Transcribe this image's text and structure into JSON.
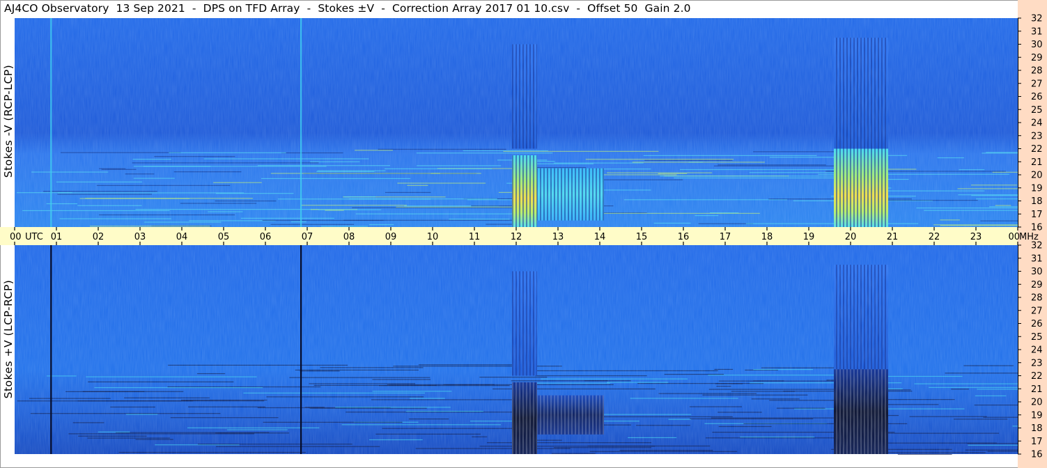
{
  "title": "AJ4CO Observatory  13 Sep 2021  -  DPS on TFD Array  -  Stokes ±V  -  Correction Array 2017 01 10.csv  -  Offset 50  Gain 2.0",
  "colors": {
    "background_blue": "#1f5fe0",
    "axis_band": "#fffcc8",
    "freq_band": "#ffdcc4",
    "cyan": "#40e0f0",
    "yellow": "#f0e040",
    "dark": "#06123a"
  },
  "chart_data": [
    {
      "type": "heatmap",
      "name": "stokes-minus-v",
      "ylabel": "Stokes -V (RCP-LCP)",
      "yunit": "MHz",
      "ylim": [
        16,
        32
      ],
      "yticks": [
        "16",
        "17",
        "18",
        "19",
        "20",
        "21",
        "22",
        "23",
        "24",
        "25",
        "26",
        "27",
        "28",
        "29",
        "30",
        "31",
        "32"
      ],
      "events": [
        {
          "start_utc": 11.9,
          "end_utc": 12.5,
          "fmin": 16,
          "fmax": 21.5,
          "kind": "bright"
        },
        {
          "start_utc": 12.5,
          "end_utc": 14.1,
          "fmin": 16.5,
          "fmax": 20.5,
          "kind": "moderate"
        },
        {
          "start_utc": 19.6,
          "end_utc": 20.9,
          "fmin": 16,
          "fmax": 22,
          "kind": "bright"
        },
        {
          "start_utc": 19.6,
          "end_utc": 20.9,
          "fmin": 22,
          "fmax": 30.5,
          "kind": "striated"
        },
        {
          "start_utc": 11.9,
          "end_utc": 12.5,
          "fmin": 22,
          "fmax": 30,
          "kind": "striated"
        }
      ],
      "vertical_lines_utc": [
        0.87,
        6.85
      ]
    },
    {
      "type": "heatmap",
      "name": "stokes-plus-v",
      "ylabel": "Stokes +V (LCP-RCP)",
      "yunit": "MHz",
      "ylim": [
        16,
        32
      ],
      "yticks": [
        "16",
        "17",
        "18",
        "19",
        "20",
        "21",
        "22",
        "23",
        "24",
        "25",
        "26",
        "27",
        "28",
        "29",
        "30",
        "31",
        "32"
      ],
      "events": [
        {
          "start_utc": 11.9,
          "end_utc": 12.5,
          "fmin": 16,
          "fmax": 21.5,
          "kind": "dark"
        },
        {
          "start_utc": 12.5,
          "end_utc": 14.1,
          "fmin": 17.5,
          "fmax": 20.5,
          "kind": "dark-moderate"
        },
        {
          "start_utc": 19.6,
          "end_utc": 20.9,
          "fmin": 16,
          "fmax": 22.5,
          "kind": "dark"
        },
        {
          "start_utc": 19.6,
          "end_utc": 20.9,
          "fmin": 22.5,
          "fmax": 30.5,
          "kind": "striated"
        },
        {
          "start_utc": 11.9,
          "end_utc": 12.5,
          "fmin": 22,
          "fmax": 30,
          "kind": "striated"
        }
      ],
      "vertical_lines_utc": [
        0.87,
        6.85
      ]
    }
  ],
  "time_axis": {
    "xlim": [
      0,
      24
    ],
    "ticks": [
      "00",
      "01",
      "02",
      "03",
      "04",
      "05",
      "06",
      "07",
      "08",
      "09",
      "10",
      "11",
      "12",
      "13",
      "14",
      "15",
      "16",
      "17",
      "18",
      "19",
      "20",
      "21",
      "22",
      "23",
      "00"
    ],
    "utc_label": "UTC",
    "mhz_label": "MHz"
  }
}
